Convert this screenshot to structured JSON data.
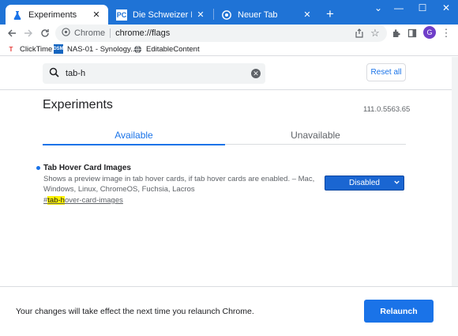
{
  "colors": {
    "titlebar": "#1f73d6",
    "accent": "#1a73e8",
    "highlight": "#fff200",
    "select_bg": "#1a66d2"
  },
  "tabs": [
    {
      "label": "Experiments",
      "icon": "flask-icon",
      "active": true
    },
    {
      "label": "Die Schweizer Plattform f",
      "icon": "pctipp-icon",
      "active": false
    },
    {
      "label": "Neuer Tab",
      "icon": "chrome-icon",
      "active": false
    }
  ],
  "window_controls": {
    "minimize": "—",
    "maximize": "☐",
    "close": "✕",
    "dropdown": "⌄"
  },
  "toolbar": {
    "omnibox_chip": "Chrome",
    "url": "chrome://flags",
    "avatar_letter": "G"
  },
  "bookmarks": [
    {
      "label": "ClickTime",
      "icon": "clicktime-icon"
    },
    {
      "label": "NAS-01 - Synology...",
      "icon": "dsm-icon"
    },
    {
      "label": "EditableContent",
      "icon": "globe-icon"
    }
  ],
  "search": {
    "value": "tab-h"
  },
  "reset_label": "Reset all",
  "page_title": "Experiments",
  "version": "111.0.5563.65",
  "tab_available": "Available",
  "tab_unavailable": "Unavailable",
  "flag": {
    "title": "Tab Hover Card Images",
    "description": "Shows a preview image in tab hover cards, if tab hover cards are enabled. – Mac, Windows, Linux, ChromeOS, Fuchsia, Lacros",
    "link_prefix": "#",
    "link_highlight": "tab-h",
    "link_rest": "over-card-images",
    "select_value": "Disabled"
  },
  "footer": {
    "message": "Your changes will take effect the next time you relaunch Chrome.",
    "relaunch_label": "Relaunch"
  }
}
